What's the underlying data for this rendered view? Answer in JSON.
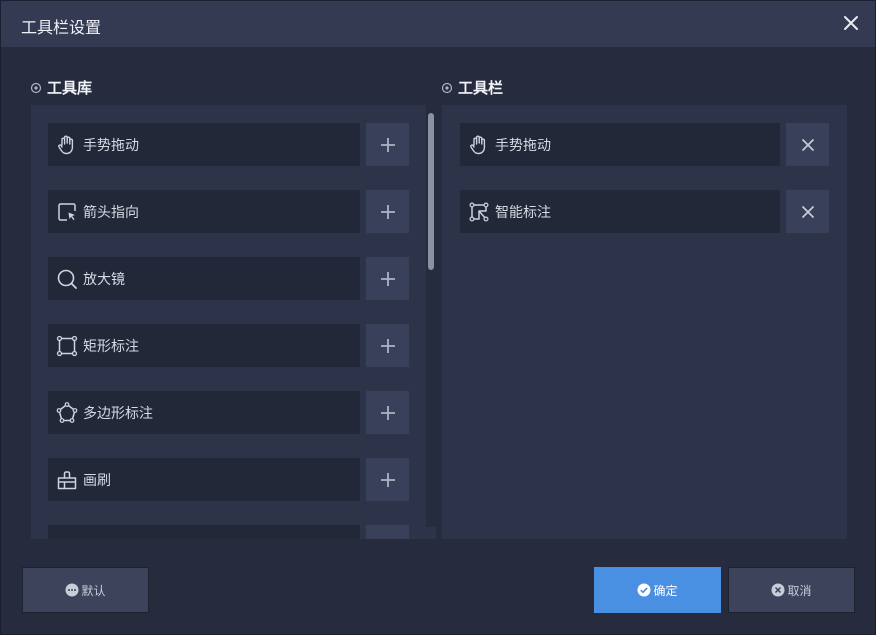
{
  "dialog": {
    "title": "工具栏设置"
  },
  "library": {
    "title": "工具库",
    "items": [
      {
        "label": "手势拖动",
        "icon": "hand-icon"
      },
      {
        "label": "箭头指向",
        "icon": "arrow-pointer-icon"
      },
      {
        "label": "放大镜",
        "icon": "magnifier-icon"
      },
      {
        "label": "矩形标注",
        "icon": "rectangle-annotation-icon"
      },
      {
        "label": "多边形标注",
        "icon": "polygon-annotation-icon"
      },
      {
        "label": "画刷",
        "icon": "brush-icon"
      },
      {
        "label": "",
        "icon": "partial-item-icon"
      }
    ]
  },
  "toolbar": {
    "title": "工具栏",
    "items": [
      {
        "label": "手势拖动",
        "icon": "hand-icon"
      },
      {
        "label": "智能标注",
        "icon": "smart-annotation-icon"
      }
    ]
  },
  "footer": {
    "default_label": "默认",
    "ok_label": "确定",
    "cancel_label": "取消"
  },
  "colors": {
    "accent": "#4a90e2",
    "background": "#262c3d",
    "titlebar": "#333a52",
    "panel": "#2d344a"
  }
}
